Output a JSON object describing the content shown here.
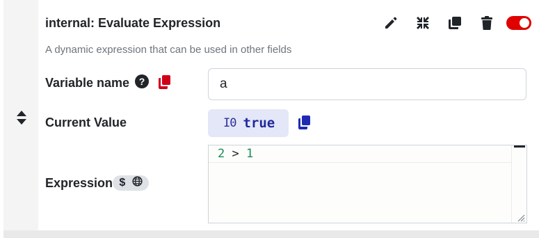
{
  "node": {
    "title": "internal: Evaluate Expression",
    "description": "A dynamic expression that can be used in other fields",
    "enabled": true
  },
  "toolbar": {
    "icons": [
      "pencil-icon",
      "compress-icon",
      "copy-icon",
      "trash-icon",
      "toggle-switch"
    ]
  },
  "fields": {
    "variable_name": {
      "label": "Variable name",
      "help": "?",
      "value": "a"
    },
    "current_value": {
      "label": "Current Value",
      "type_glyph": "I0",
      "value": "true"
    },
    "expression": {
      "label": "Expression",
      "badge_dollar": "$",
      "code_left": "2",
      "code_op": " > ",
      "code_right": "1"
    }
  },
  "colors": {
    "toggle_on": "#e00000",
    "copy_red": "#d00018",
    "copy_blue": "#1d2cb3",
    "chip_bg": "#e4e7f7",
    "code_number": "#1b8a5a"
  }
}
